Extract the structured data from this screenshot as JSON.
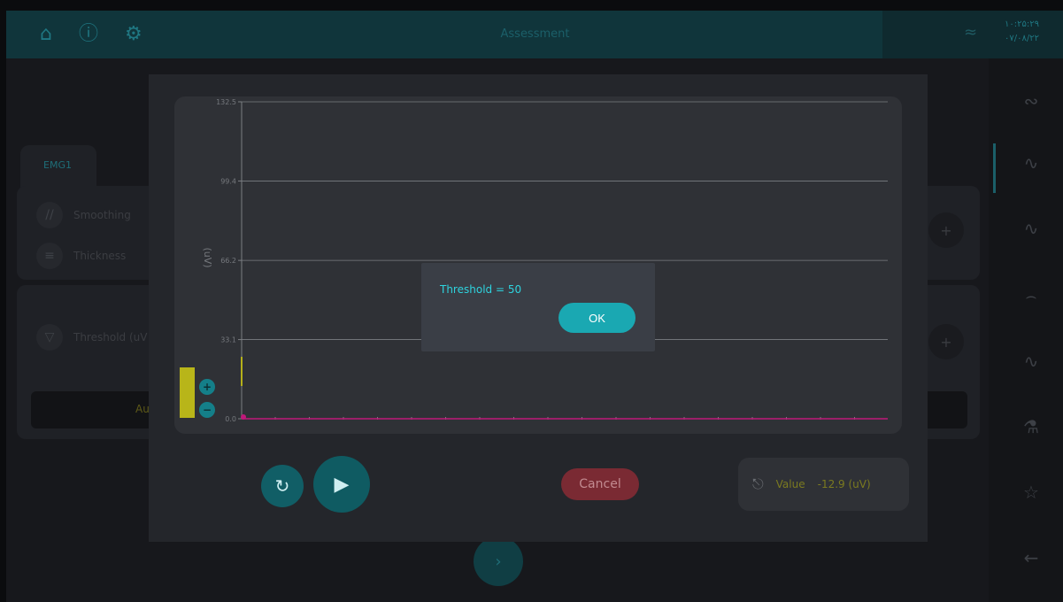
{
  "header": {
    "title": "Assessment",
    "clock_line1": "۱۰:۲۵:۲۹",
    "clock_line2": "۰۷/۰۸/۲۲",
    "nav_icons": [
      "home-icon",
      "help-icon",
      "settings-icon"
    ],
    "status_icon": "wifi-off-icon"
  },
  "sidebar": {
    "icons": [
      "emg-signal-icon",
      "emg-view-icon",
      "emg-burst-icon",
      "wave-smooth-icon",
      "wave-sine-icon",
      "car-icon",
      "star-list-icon",
      "back-arrow-icon"
    ]
  },
  "background": {
    "tab_label": "EMG1",
    "smoothing_label": "Smoothing",
    "thickness_label": "Thickness",
    "threshold_label": "Threshold (uV",
    "auto_label": "Au",
    "plus_label": "+",
    "next_label": "›"
  },
  "chart_data": {
    "type": "line",
    "ylabel": "(uV)",
    "y_ticks": [
      "132.5",
      "99.4",
      "66.2",
      "33.1",
      "0.0"
    ],
    "ylim": [
      0,
      132.5
    ],
    "grid": true,
    "series": [
      {
        "color": "#c0187a",
        "values": [
          0,
          0,
          0,
          0,
          0,
          0,
          0,
          0,
          0,
          0,
          0,
          0,
          0,
          0,
          0,
          0,
          0,
          0,
          0,
          0
        ]
      }
    ],
    "threshold_marker_color": "#b5b01a",
    "level_bar_color": "#b8b519"
  },
  "controls": {
    "zoom_in": "+",
    "zoom_out": "−",
    "reset_icon": "reset-icon",
    "play_icon": "play-icon",
    "cancel_label": "Cancel",
    "value_label": "Value",
    "value_text": "-12.9 (uV)"
  },
  "alert": {
    "message": "Threshold = 50",
    "ok_label": "OK"
  }
}
